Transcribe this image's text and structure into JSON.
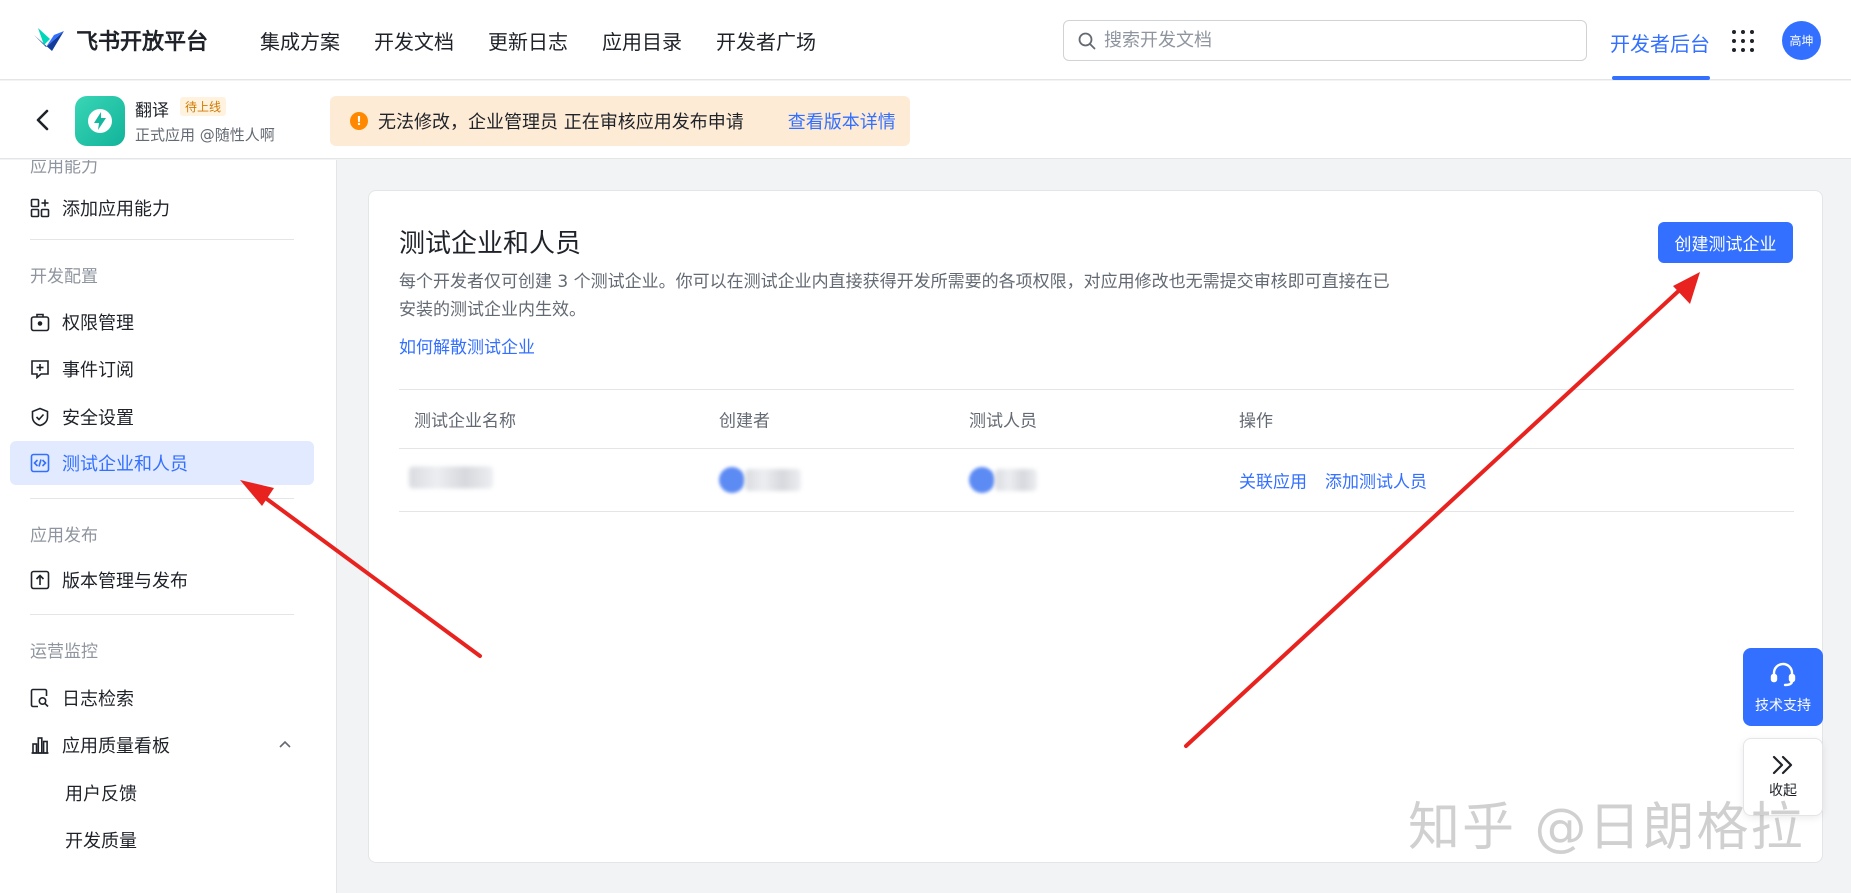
{
  "topbar": {
    "brand": "飞书开放平台",
    "nav": [
      "集成方案",
      "开发文档",
      "更新日志",
      "应用目录",
      "开发者广场"
    ],
    "search_placeholder": "搜索开发文档",
    "dev_console": "开发者后台",
    "avatar_text": "高坤"
  },
  "app": {
    "name": "翻译",
    "badge": "待上线",
    "subtitle": "正式应用 @随性人啊"
  },
  "notice": {
    "text": "无法修改，企业管理员 正在审核应用发布申请",
    "link": "查看版本详情"
  },
  "sidebar": {
    "cut_heading": "应用能力",
    "add_capability": "添加应用能力",
    "group_dev": "开发配置",
    "items_dev": [
      "权限管理",
      "事件订阅",
      "安全设置",
      "测试企业和人员"
    ],
    "group_release": "应用发布",
    "items_release": [
      "版本管理与发布"
    ],
    "group_ops": "运营监控",
    "items_ops": [
      "日志检索",
      "应用质量看板"
    ],
    "sub_items": [
      "用户反馈",
      "开发质量"
    ]
  },
  "main": {
    "title": "测试企业和人员",
    "desc": "每个开发者仅可创建 3 个测试企业。你可以在测试企业内直接获得开发所需要的各项权限，对应用修改也无需提交审核即可直接在已安装的测试企业内生效。",
    "help_link": "如何解散测试企业",
    "create_button": "创建测试企业",
    "columns": [
      "测试企业名称",
      "创建者",
      "测试人员",
      "操作"
    ],
    "row_actions": [
      "关联应用",
      "添加测试人员"
    ]
  },
  "floating": {
    "support": "技术支持",
    "collapse": "收起"
  },
  "watermark": "知乎 @日朗格拉",
  "colors": {
    "accent": "#3370ff",
    "notice_bg": "#fdebd6",
    "annotation_arrow": "#e8231f"
  }
}
